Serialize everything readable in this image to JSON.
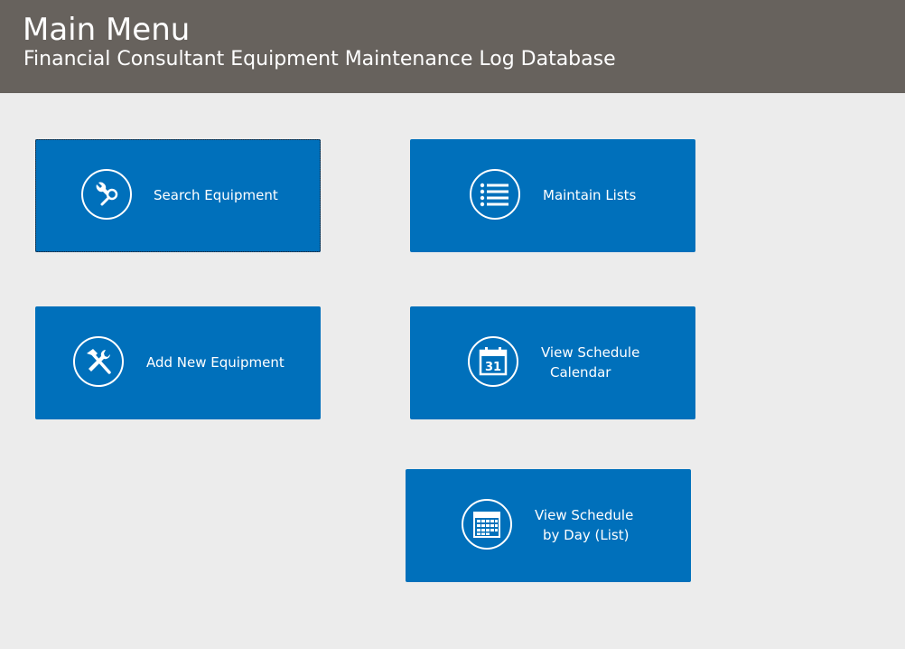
{
  "header": {
    "title": "Main Menu",
    "subtitle": "Financial Consultant Equipment Maintenance Log Database"
  },
  "tiles": [
    {
      "label": "Search Equipment",
      "icon": "tools-search-icon"
    },
    {
      "label": "Maintain Lists",
      "icon": "list-icon"
    },
    {
      "label": "Add New Equipment",
      "icon": "wrench-hammer-icon"
    },
    {
      "label_line1": "View Schedule",
      "label_line2": "Calendar",
      "icon": "calendar-day-icon",
      "day_number": "31"
    },
    {
      "label_line1": "View Schedule",
      "label_line2": "by Day (List)",
      "icon": "calendar-grid-icon"
    }
  ],
  "colors": {
    "header_bg": "#67625d",
    "page_bg": "#ececec",
    "tile_bg": "#0070bb",
    "text": "#ffffff"
  }
}
